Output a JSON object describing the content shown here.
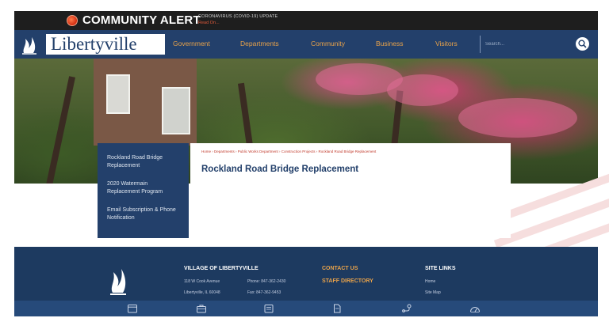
{
  "alert": {
    "title": "COMMUNITY ALERT",
    "subtitle": "CORONAVIRUS (COVID-19) UPDATE",
    "link": "Read On..."
  },
  "header": {
    "logo_text": "Libertyville",
    "nav": [
      "Government",
      "Departments",
      "Community",
      "Business",
      "Visitors"
    ],
    "search_placeholder": "Search..."
  },
  "sidebar": {
    "links": [
      "Rockland Road Bridge Replacement",
      "2020 Watermain Replacement Program",
      "Email Subscription & Phone Notification"
    ]
  },
  "main": {
    "breadcrumb": "Home › Departments › Public Works Department › Construction Projects › Rockland Road Bridge Replacement",
    "title": "Rockland Road Bridge Replacement"
  },
  "footer": {
    "village": {
      "heading": "VILLAGE OF LIBERTYVILLE",
      "address1": "118 W Cook Avenue",
      "address2": "Libertyville, IL 60048",
      "phone": "Phone: 847-362-2430",
      "fax": "Fax: 847-362-9453"
    },
    "contact": {
      "heading": "CONTACT US",
      "staff": "STAFF DIRECTORY"
    },
    "site_links": {
      "heading": "SITE LINKS",
      "items": [
        "Home",
        "Site Map"
      ]
    }
  },
  "bottom_icons": [
    "calendar-icon",
    "briefcase-icon",
    "news-icon",
    "document-icon",
    "directions-icon",
    "dashboard-icon"
  ],
  "colors": {
    "navy": "#23406b",
    "orange": "#e8a24a",
    "alert_red": "#d12c12"
  }
}
